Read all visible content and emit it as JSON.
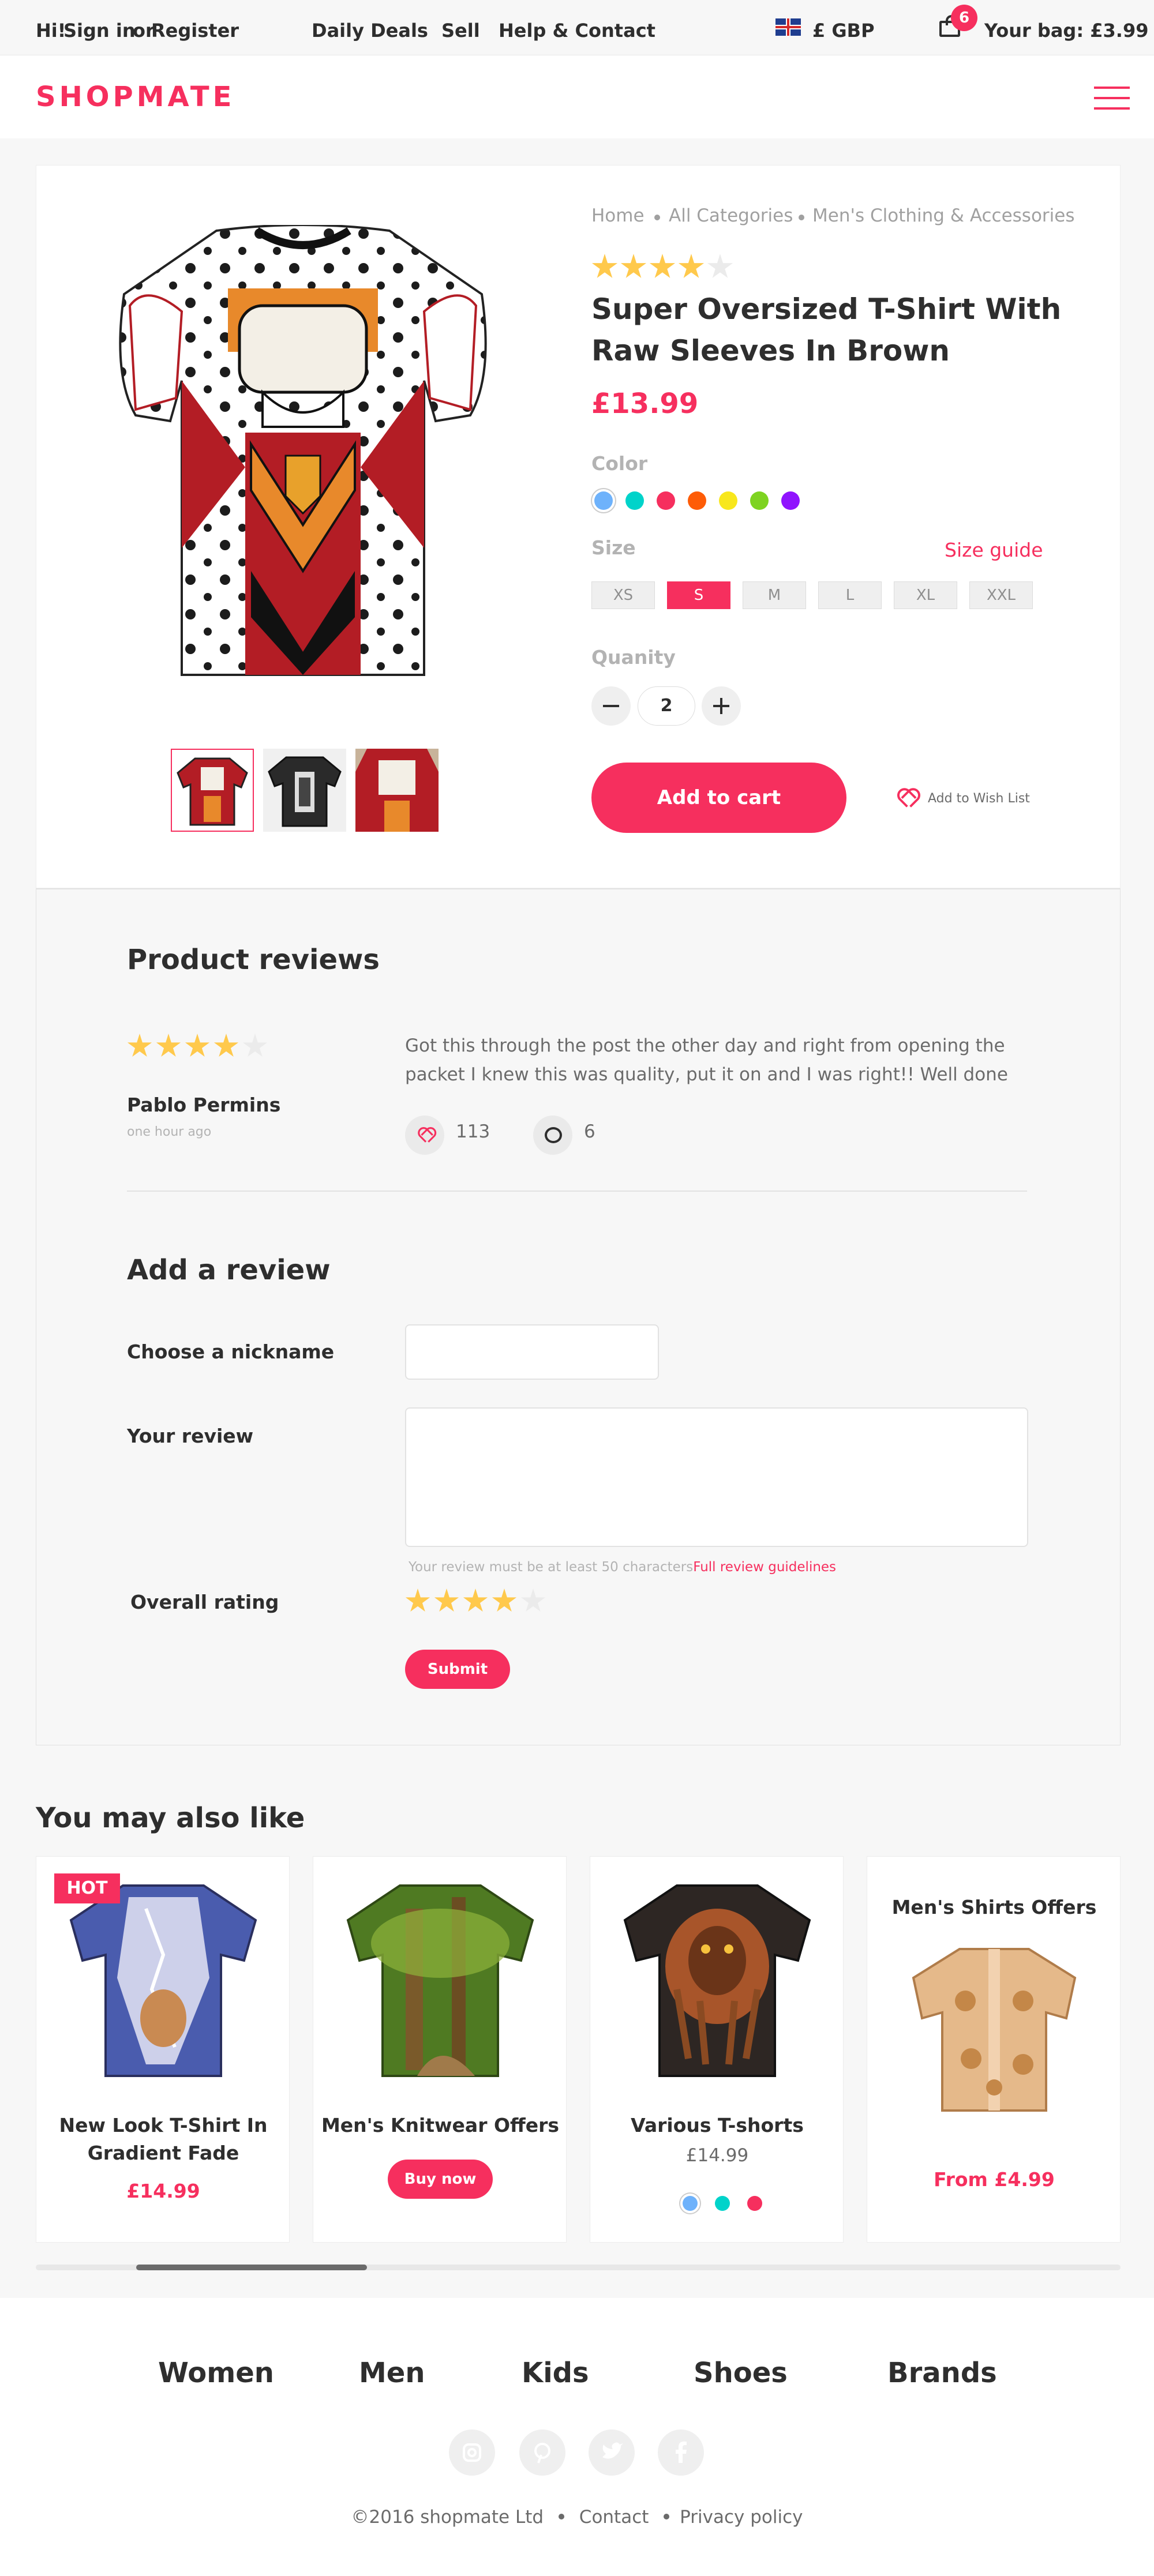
{
  "topbar": {
    "greeting": "Hi!",
    "sign_in": "Sign in",
    "or": "or",
    "register": "Register",
    "nav": [
      "Daily Deals",
      "Sell",
      "Help & Contact"
    ],
    "currency": "£ GBP",
    "bag_count": "6",
    "bag_label": "Your bag: £3.99"
  },
  "header": {
    "logo": "SHOPMATE"
  },
  "product": {
    "breadcrumb": [
      "Home",
      "All Categories",
      "Men's Clothing & Accessories"
    ],
    "rating": 4,
    "title": "Super Oversized T-Shirt With Raw Sleeves In Brown",
    "price": "£13.99",
    "color_label": "Color",
    "colors": [
      "#6eb2fb",
      "#00d3ca",
      "#f62f5e",
      "#fe5c07",
      "#f8e71c",
      "#7ed321",
      "#9013fe"
    ],
    "size_label": "Size",
    "size_guide": "Size guide",
    "sizes": [
      "XS",
      "S",
      "M",
      "L",
      "XL",
      "XXL"
    ],
    "selected_size": "S",
    "quantity_label": "Quanity",
    "quantity": "2",
    "add_to_cart": "Add to cart",
    "wish_list": "Add to Wish List"
  },
  "reviews": {
    "heading": "Product reviews",
    "items": [
      {
        "rating": 4,
        "author": "Pablo Permins",
        "time": "one hour ago",
        "text": "Got this through the post the other day and right from opening the packet I knew this was quality, put it on and I was right!! Well done",
        "likes": "113",
        "comments": "6"
      }
    ]
  },
  "add_review": {
    "heading": "Add a review",
    "nickname_label": "Choose a nickname",
    "review_label": "Your review",
    "hint": "Your review must be at least 50 characters",
    "guidelines": "Full review guidelines",
    "rating_label": "Overall rating",
    "rating": 4,
    "submit": "Submit"
  },
  "recommendations": {
    "heading": "You may also like",
    "hot_badge": "HOT",
    "items": [
      {
        "title": "New Look T-Shirt In Gradient Fade",
        "price": "£14.99"
      },
      {
        "title": "Men's Knitwear Offers",
        "button": "Buy now"
      },
      {
        "title": "Various T-shorts",
        "price": "£14.99",
        "colors": [
          "#6eb2fb",
          "#00d3ca",
          "#f62f5e"
        ]
      },
      {
        "title": "Men's Shirts Offers",
        "price": "From £4.99"
      }
    ],
    "scroll_position": 0.09
  },
  "footer": {
    "nav": [
      "Women",
      "Men",
      "Kids",
      "Shoes",
      "Brands"
    ],
    "social": [
      "instagram-icon",
      "pinterest-icon",
      "twitter-icon",
      "facebook-icon"
    ],
    "copyright": "©2016 shopmate Ltd",
    "contact": "Contact",
    "privacy": "Privacy policy"
  },
  "colors": {
    "accent": "#f62f5e",
    "star": "#ffc94c"
  }
}
